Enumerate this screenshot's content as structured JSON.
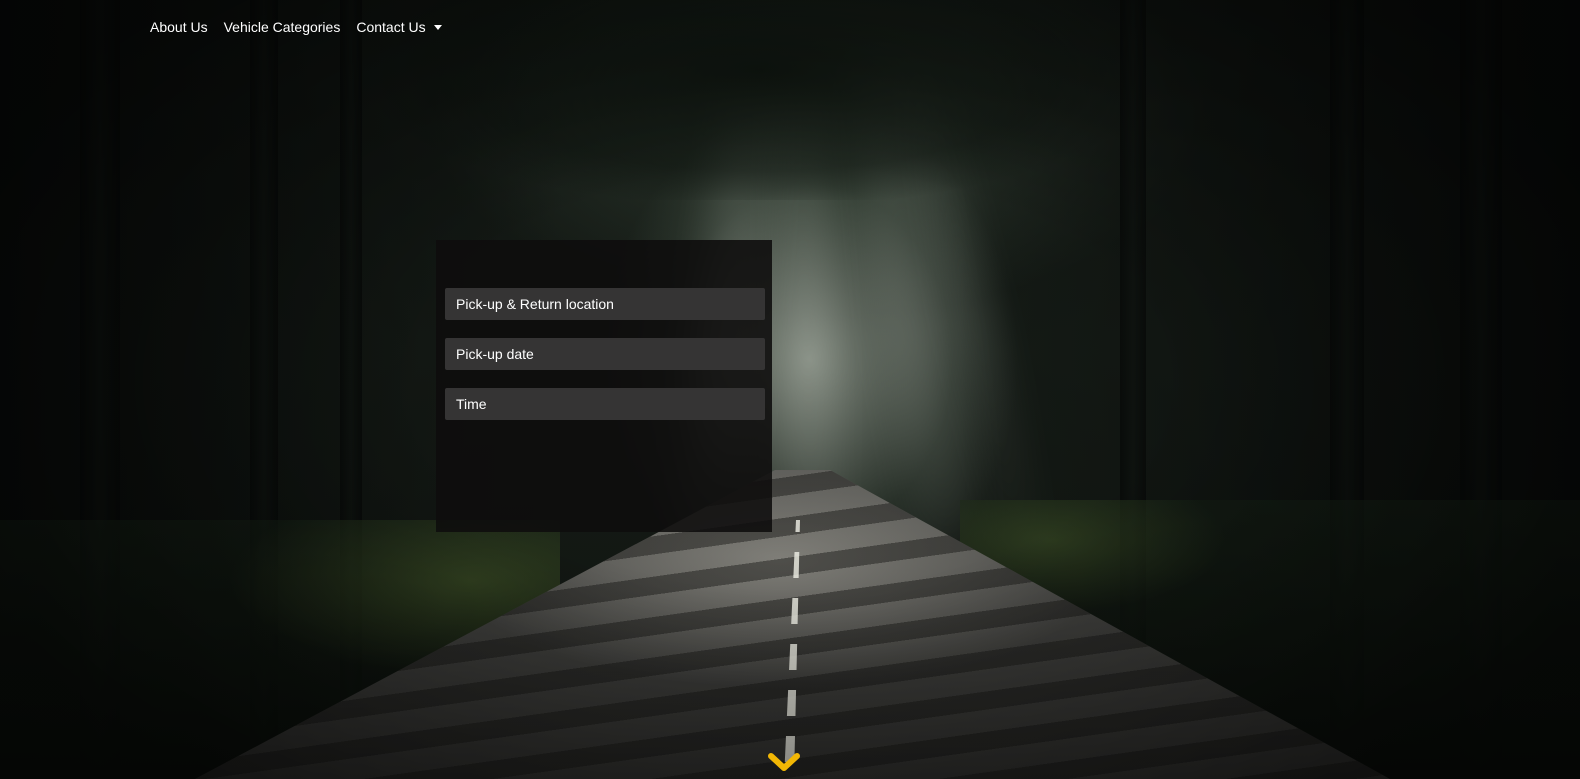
{
  "nav": {
    "items": [
      {
        "label": "About Us"
      },
      {
        "label": "Vehicle Categories"
      },
      {
        "label": "Contact Us",
        "has_dropdown": true
      }
    ]
  },
  "booking": {
    "location_placeholder": "Pick-up & Return location",
    "date_placeholder": "Pick-up date",
    "time_placeholder": "Time"
  },
  "scroll_indicator": {
    "icon": "chevron-down-icon",
    "color": "#f2b705"
  },
  "colors": {
    "panel_bg": "#0e0c0c",
    "field_bg": "#353434",
    "text": "#ffffff"
  }
}
